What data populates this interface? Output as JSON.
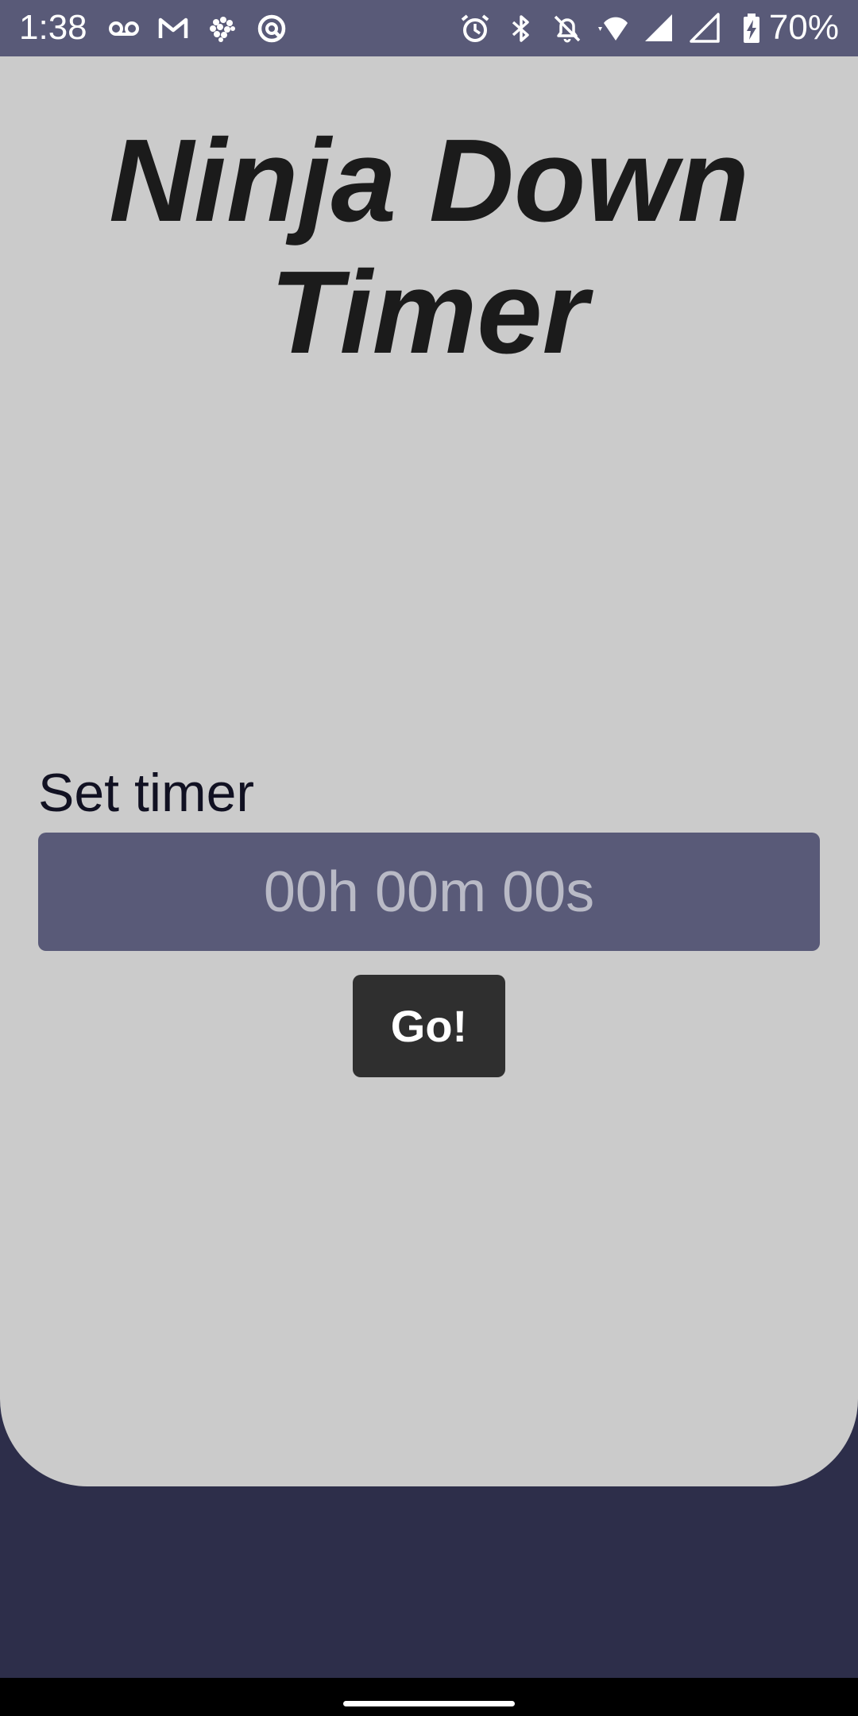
{
  "status_bar": {
    "time": "1:38",
    "battery_percent": "70%",
    "left_icons": [
      "voicemail-icon",
      "gmail-icon",
      "brain-app-icon",
      "sync-app-icon"
    ],
    "right_icons": [
      "alarm-icon",
      "bluetooth-icon",
      "notifications-off-icon",
      "wifi-icon",
      "cell-signal-icon",
      "cell-signal-2-icon",
      "battery-charging-icon"
    ]
  },
  "app": {
    "title": "Ninja Down Timer",
    "timer_label": "Set timer",
    "timer_input": {
      "value": "",
      "placeholder": "00h 00m 00s"
    },
    "go_label": "Go!"
  },
  "colors": {
    "status_bar": "#595a78",
    "card": "#cbcbcb",
    "background": "#2d2e4a",
    "input": "#595a78",
    "button": "#2f2f2f"
  }
}
